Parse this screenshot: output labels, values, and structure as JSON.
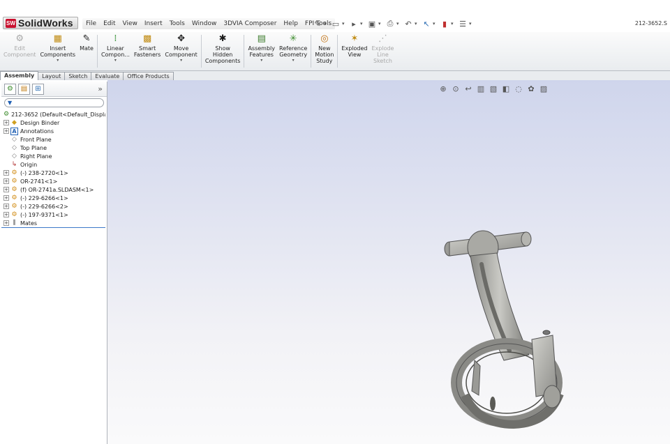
{
  "app": {
    "brand": "SolidWorks",
    "brand_color": "#c8102e",
    "document_title": "212-3652.S"
  },
  "menu": [
    "File",
    "Edit",
    "View",
    "Insert",
    "Tools",
    "Window",
    "3DVIA Composer",
    "Help",
    "FPI Tools"
  ],
  "quick_tools": [
    "pin-icon",
    "new-icon",
    "open-icon",
    "save-icon",
    "print-icon",
    "undo-icon",
    "select-icon",
    "rebuild-icon",
    "options-icon"
  ],
  "commands": [
    {
      "label": "Edit\nComponent",
      "icon": "edit-component-icon",
      "disabled": true,
      "dropdown": false
    },
    {
      "label": "Insert\nComponents",
      "icon": "insert-components-icon",
      "disabled": false,
      "dropdown": true
    },
    {
      "label": "Mate",
      "icon": "mate-icon",
      "disabled": false,
      "dropdown": false
    },
    {
      "label": "Linear\nCompon...",
      "icon": "linear-pattern-icon",
      "disabled": false,
      "dropdown": true
    },
    {
      "label": "Smart\nFasteners",
      "icon": "smart-fasteners-icon",
      "disabled": false,
      "dropdown": false
    },
    {
      "label": "Move\nComponent",
      "icon": "move-component-icon",
      "disabled": false,
      "dropdown": true
    },
    {
      "label": "Show\nHidden\nComponents",
      "icon": "show-hidden-icon",
      "disabled": false,
      "dropdown": false
    },
    {
      "label": "Assembly\nFeatures",
      "icon": "assembly-features-icon",
      "disabled": false,
      "dropdown": true
    },
    {
      "label": "Reference\nGeometry",
      "icon": "reference-geometry-icon",
      "disabled": false,
      "dropdown": true
    },
    {
      "label": "New\nMotion\nStudy",
      "icon": "motion-study-icon",
      "disabled": false,
      "dropdown": false
    },
    {
      "label": "Exploded\nView",
      "icon": "exploded-view-icon",
      "disabled": false,
      "dropdown": false
    },
    {
      "label": "Explode\nLine\nSketch",
      "icon": "explode-line-icon",
      "disabled": true,
      "dropdown": false
    }
  ],
  "tabs": [
    {
      "label": "Assembly",
      "active": true
    },
    {
      "label": "Layout",
      "active": false
    },
    {
      "label": "Sketch",
      "active": false
    },
    {
      "label": "Evaluate",
      "active": false
    },
    {
      "label": "Office Products",
      "active": false
    }
  ],
  "feature_manager": {
    "filter_label": "▼",
    "tree": [
      {
        "label": "212-3652  (Default<Default_Displa",
        "icon": "assembly-icon",
        "expand": "none",
        "root": true
      },
      {
        "label": "Design Binder",
        "icon": "design-binder-icon",
        "expand": "+"
      },
      {
        "label": "Annotations",
        "icon": "annotations-icon",
        "expand": "+"
      },
      {
        "label": "Front Plane",
        "icon": "plane-icon",
        "expand": "none"
      },
      {
        "label": "Top Plane",
        "icon": "plane-icon",
        "expand": "none"
      },
      {
        "label": "Right Plane",
        "icon": "plane-icon",
        "expand": "none"
      },
      {
        "label": "Origin",
        "icon": "origin-icon",
        "expand": "none"
      },
      {
        "label": "(-) 238-2720<1>",
        "icon": "part-icon",
        "expand": "+"
      },
      {
        "label": "OR-2741<1>",
        "icon": "part-icon",
        "expand": "+"
      },
      {
        "label": "(f) OR-2741a.SLDASM<1>",
        "icon": "part-icon",
        "expand": "+"
      },
      {
        "label": "(-) 229-6266<1>",
        "icon": "part-icon",
        "expand": "+"
      },
      {
        "label": "(-) 229-6266<2>",
        "icon": "part-icon",
        "expand": "+"
      },
      {
        "label": "(-) 197-9371<1>",
        "icon": "part-icon",
        "expand": "+"
      },
      {
        "label": "Mates",
        "icon": "mates-icon",
        "expand": "+"
      }
    ]
  },
  "view_toolbar": [
    "zoom-to-fit-icon",
    "zoom-area-icon",
    "previous-view-icon",
    "section-view-icon",
    "view-orientation-icon",
    "display-style-icon",
    "hide-show-icon",
    "appearance-icon",
    "scene-icon"
  ]
}
